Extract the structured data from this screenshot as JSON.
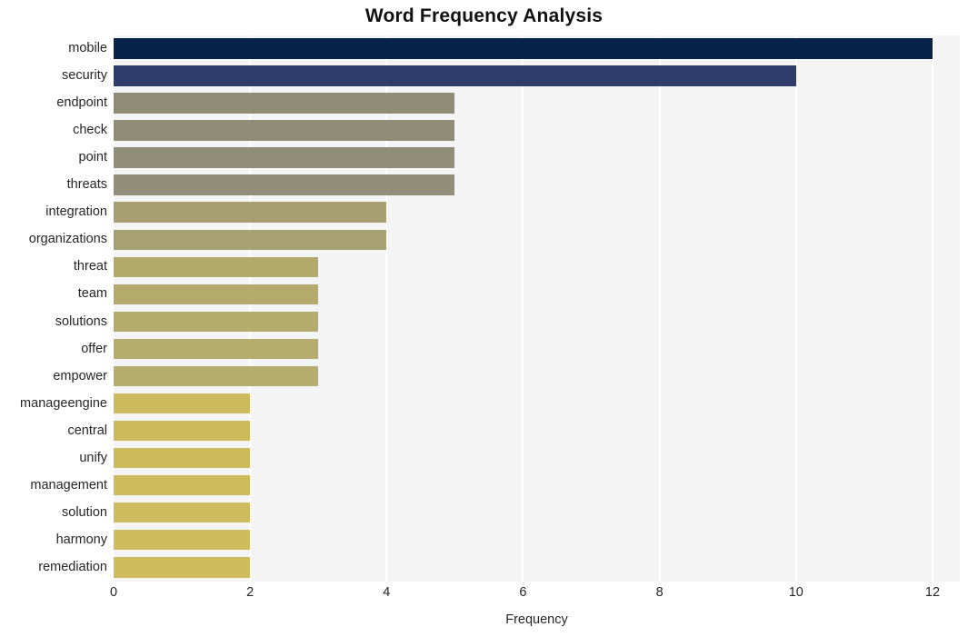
{
  "chart_data": {
    "type": "bar",
    "orientation": "horizontal",
    "title": "Word Frequency Analysis",
    "xlabel": "Frequency",
    "ylabel": "",
    "xlim": [
      0,
      12.4
    ],
    "xticks": [
      0,
      2,
      4,
      6,
      8,
      10,
      12
    ],
    "xtick_labels": [
      "0",
      "2",
      "4",
      "6",
      "8",
      "10",
      "12"
    ],
    "grid": true,
    "grid_axis": "x",
    "grid_color": "#ffffff",
    "plot_background": "#f4f4f5",
    "figure_background": "#ffffff",
    "legend": null,
    "categories": [
      "mobile",
      "security",
      "endpoint",
      "check",
      "point",
      "threats",
      "integration",
      "organizations",
      "threat",
      "team",
      "solutions",
      "offer",
      "empower",
      "manageengine",
      "central",
      "unify",
      "management",
      "solution",
      "harmony",
      "remediation"
    ],
    "values": [
      12,
      10,
      5,
      5,
      5,
      5,
      4,
      4,
      3,
      3,
      3,
      3,
      3,
      2,
      2,
      2,
      2,
      2,
      2,
      2
    ],
    "bar_colors": [
      "#08234a",
      "#2e3c6b",
      "#8f8b77",
      "#908c78",
      "#918d79",
      "#928e7a",
      "#a79f70",
      "#a8a071",
      "#b3a96a",
      "#b4aa6b",
      "#b5ab6c",
      "#b6ac6d",
      "#b7ad6e",
      "#cdba5c",
      "#cdba5c",
      "#cdba5c",
      "#cebb5d",
      "#cebb5d",
      "#cfbc5e",
      "#cfbc5e"
    ]
  }
}
